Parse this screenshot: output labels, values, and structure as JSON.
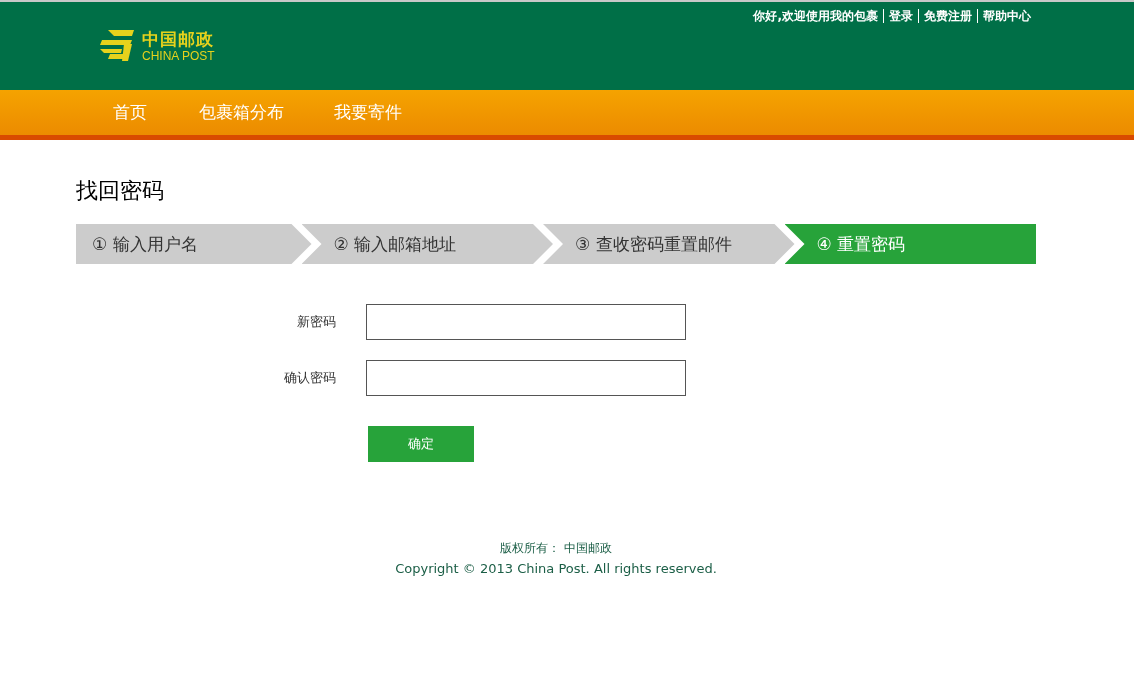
{
  "header": {
    "logo": {
      "name_cn": "中国邮政",
      "name_en": "CHINA POST"
    },
    "welcome": "你好,欢迎使用我的包裹",
    "top_links": [
      {
        "label": "登录"
      },
      {
        "label": "免费注册"
      },
      {
        "label": "帮助中心"
      }
    ]
  },
  "nav": [
    {
      "label": "首页",
      "selected": false
    },
    {
      "label": "包裹箱分布",
      "selected": false
    },
    {
      "label": "我要寄件",
      "selected": false
    }
  ],
  "page_title": "找回密码",
  "steps": [
    {
      "label": "① 输入用户名",
      "selected": false
    },
    {
      "label": "② 输入邮箱地址",
      "selected": false
    },
    {
      "label": "③ 查收密码重置邮件",
      "selected": false
    },
    {
      "label": "④ 重置密码",
      "selected": true
    }
  ],
  "form": {
    "fields": [
      {
        "label": "新密码"
      },
      {
        "label": "确认密码"
      }
    ],
    "submit": "确定"
  },
  "footer": {
    "owner": "版权所有： 中国邮政",
    "copyright": "Copyright © 2013 China Post. All rights reserved."
  }
}
